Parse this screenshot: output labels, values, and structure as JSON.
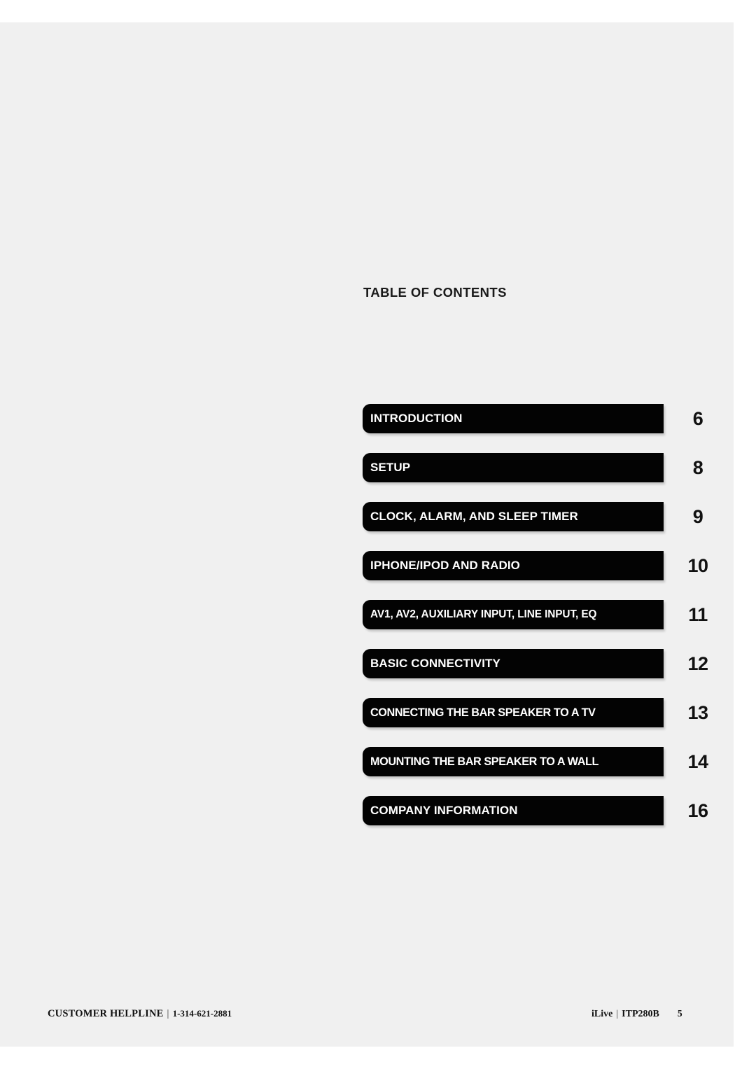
{
  "page": {
    "background_color": "#f0f0f0",
    "sheet_color": "#f0f0f0",
    "bar_color": "#030303",
    "bar_text_color": "#ffffff"
  },
  "heading": {
    "title": "TABLE OF CONTENTS"
  },
  "contents": [
    {
      "label": "INTRODUCTION",
      "page": "6"
    },
    {
      "label": "SETUP",
      "page": "8"
    },
    {
      "label": "CLOCK, ALARM, AND SLEEP TIMER",
      "page": "9"
    },
    {
      "label": "IPHONE/IPOD AND RADIO",
      "page": "10"
    },
    {
      "label": "AV1, AV2, AUXILIARY INPUT, LINE INPUT, EQ",
      "page": "11"
    },
    {
      "label": "BASIC CONNECTIVITY",
      "page": "12"
    },
    {
      "label": "CONNECTING THE BAR SPEAKER TO A TV",
      "page": "13"
    },
    {
      "label": "MOUNTING THE BAR SPEAKER TO A WALL",
      "page": "14"
    },
    {
      "label": "COMPANY INFORMATION",
      "page": "16"
    }
  ],
  "footer": {
    "helpline_label": "CUSTOMER HELPLINE",
    "separator": "|",
    "helpline_number": "1-314-621-2881",
    "brand": "iLive",
    "model": "ITP280B",
    "folio": "5"
  }
}
